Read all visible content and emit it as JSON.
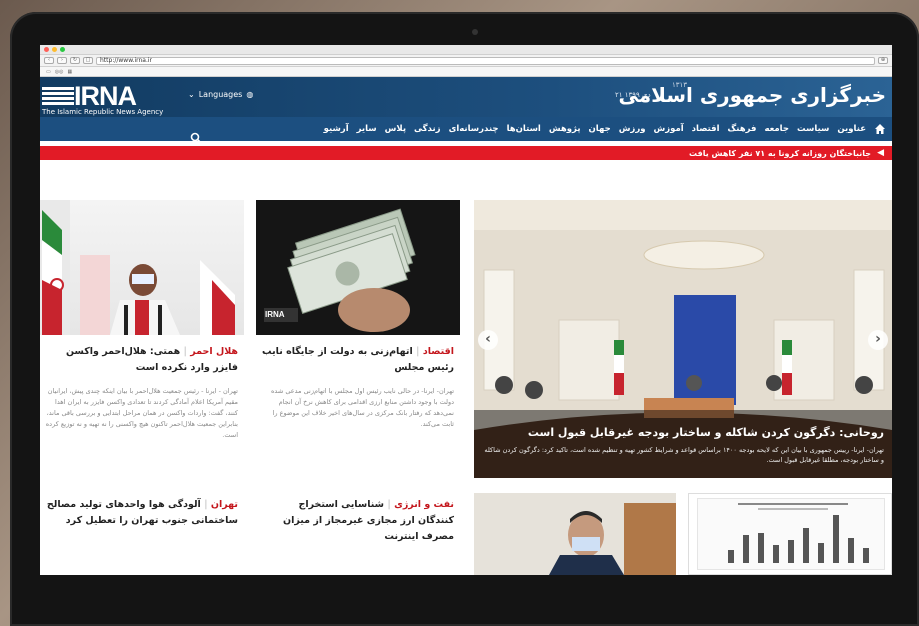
{
  "browser": {
    "url": "http://www.irna.ir"
  },
  "site": {
    "logo_text": "IRNA",
    "logo_sub": "The Islamic Republic News Agency",
    "languages_label": "Languages",
    "date": "۲۱ دی ۱۳۹۹",
    "brand_fa": "خبرگزاری جمهوری اسلامی",
    "brand_year": "۱۳۱۳"
  },
  "nav": {
    "items": [
      "عناوین",
      "سیاست",
      "جامعه",
      "فرهنگ",
      "اقتصاد",
      "آموزش",
      "ورزش",
      "جهان",
      "پژوهش",
      "استان‌ها",
      "چندرسانه‌ای",
      "زندگی",
      "پلاس",
      "سایر",
      "آرشیو"
    ]
  },
  "ticker": {
    "text": "جانباختگان روزانه کرونا به ۷۱ نفر کاهش یافت"
  },
  "hero": {
    "title": "روحانی: دگرگون کردن شاکله و ساختار بودجه غیرقابل قبول است",
    "desc": "تهران- ایرنا- رییس جمهوری با بیان این که لایحه بودجه ۱۴۰۰ براساس قواعد و شرایط کشور تهیه و تنظیم شده است، تاکید کرد: دگرگون کردن شاکله و ساختار بودجه، مطلقا غیرقابل قبول است."
  },
  "card_economy": {
    "category": "اقتصاد",
    "title": "اتهام‌زنی به دولت از جایگاه نایب رئیس مجلس",
    "desc": "تهران- ایرنا- در حالی نایب رئیس اول مجلس با اتهام‌زنی مدعی شده دولت با وجود داشتن منابع ارزی اقدامی برای کاهش نرخ آن انجام نمی‌دهد که رفتار بانک مرکزی در سال‌های اخیر خلاف این موضوع را ثابت می‌کند."
  },
  "card_redcrescent": {
    "category": "هلال احمر",
    "title": "همتی: هلال‌احمر واکسن فایزر وارد نکرده است",
    "desc": "تهران - ایرنا - رئیس جمعیت هلال‌احمر با بیان اینکه چندی پیش، ایرانیان مقیم آمریکا اعلام آمادگی کردند تا تعدادی واکسن فایزر به ایران اهدا کنند، گفت: واردات واکسن در همان مراحل ابتدایی و بررسی باقی ماند، بنابراین جمعیت هلال‌احمر تاکنون هیچ واکسنی را نه تهیه و نه توزیع کرده است."
  },
  "card_oil": {
    "category": "نفت و انرژی",
    "title": "شناسایی استخراج کنندگان ارز مجازی غیرمجاز از میزان مصرف اینترنت"
  },
  "card_tehran": {
    "category": "تهران",
    "title": "آلودگی هوا واحدهای تولید مصالح ساختمانی جنوب تهران را تعطیل کرد"
  },
  "photo_tag": "IRNA",
  "chart_bars": [
    0.25,
    0.55,
    0.6,
    0.35,
    0.45,
    0.7,
    0.4,
    0.95,
    0.5,
    0.3
  ]
}
